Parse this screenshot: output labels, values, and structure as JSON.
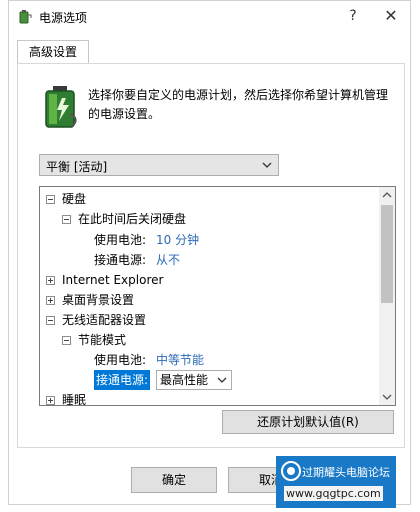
{
  "window": {
    "title": "电源选项",
    "help_button": "?",
    "close_button": "✕"
  },
  "tabs": [
    {
      "label": "高级设置"
    }
  ],
  "description": "选择你要自定义的电源计划，然后选择你希望计算机管理的电源设置。",
  "plan_select": {
    "value": "平衡 [活动]"
  },
  "tree": {
    "items": [
      {
        "label": "硬盘"
      },
      {
        "label": "在此时间后关闭硬盘"
      },
      {
        "setting": "使用电池:",
        "value": "10 分钟"
      },
      {
        "setting": "接通电源:",
        "value": "从不"
      },
      {
        "label": "Internet Explorer"
      },
      {
        "label": "桌面背景设置"
      },
      {
        "label": "无线适配器设置"
      },
      {
        "label": "节能模式"
      },
      {
        "setting": "使用电池:",
        "value": "中等节能"
      },
      {
        "setting": "接通电源:",
        "value": "最高性能"
      },
      {
        "label": "睡眠"
      }
    ]
  },
  "restore_button": "还原计划默认值(R)",
  "ok_button": "确定",
  "cancel_button": "取消",
  "watermark": {
    "title": "过期耀头电脑论坛",
    "url": "www.gqgtpc.com"
  },
  "colors": {
    "accent": "#0078d7",
    "value_text": "#2c6ab6"
  }
}
